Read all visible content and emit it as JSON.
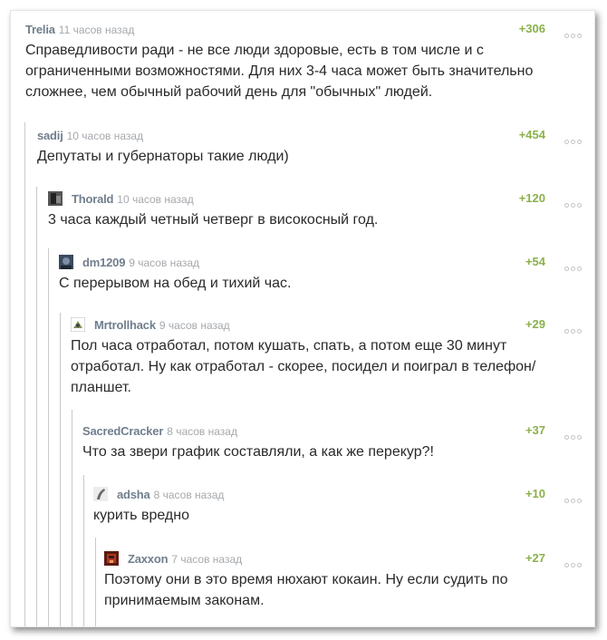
{
  "comments": [
    {
      "author": "Trelia",
      "time": "11 часов назад",
      "rating": "+306",
      "text": "Справедливости ради - не все люди здоровые, есть в том числе и с ограниченными возможностями. Для них 3-4 часа может быть значительно сложнее, чем обычный рабочий день для \"обычных\" людей."
    },
    {
      "author": "sadij",
      "time": "10 часов назад",
      "rating": "+454",
      "text": "Депутаты и губернаторы такие люди)"
    },
    {
      "author": "Thorald",
      "time": "10 часов назад",
      "rating": "+120",
      "text": "3 часа каждый четный четверг в високосный год."
    },
    {
      "author": "dm1209",
      "time": "9 часов назад",
      "rating": "+54",
      "text": "С перерывом на обед и тихий час."
    },
    {
      "author": "Mrtrollhack",
      "time": "9 часов назад",
      "rating": "+29",
      "text": "Пол часа отработал, потом кушать, спать, а потом еще 30 минут отработал. Ну как отработал - скорее, посидел и поиграл в телефон/планшет."
    },
    {
      "author": "SacredCracker",
      "time": "8 часов назад",
      "rating": "+37",
      "text": "Что за звери график составляли, а как же перекур?!"
    },
    {
      "author": "adsha",
      "time": "8 часов назад",
      "rating": "+10",
      "text": "курить вредно"
    },
    {
      "author": "Zaxxon",
      "time": "7 часов назад",
      "rating": "+27",
      "text": "Поэтому они в это время нюхают кокаин. Ну если судить по принимаемым законам."
    }
  ]
}
